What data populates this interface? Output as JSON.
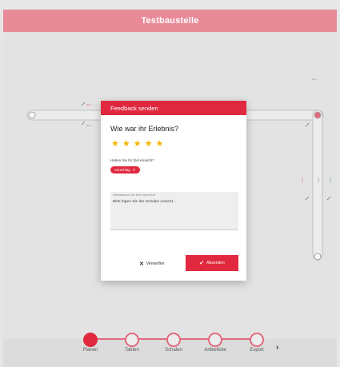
{
  "app": {
    "title": "Testbaustelle"
  },
  "colors": {
    "accent": "#e0293f",
    "header": "#e88a98",
    "star": "#f4b400"
  },
  "canvas": {
    "marks": [
      "30,6",
      "30,6",
      "24,0",
      "24,0",
      "24,0",
      "24,0"
    ]
  },
  "feedback_dialog": {
    "title": "Feedback senden",
    "question": "Wie war ihr Erlebnis?",
    "rating": 5,
    "rating_max": 5,
    "goal_question": "Haben Sie ihr Ziel erreicht?",
    "chip_label": "Vorschlag",
    "message_label": "Hinterlassen Sie eine Nachricht",
    "message_value": "Bitte fügen Sie der Schalen Ansicht...",
    "discard_label": "Verwerfen",
    "send_label": "Absenden",
    "discard_icon": "close-icon",
    "send_icon": "check-icon"
  },
  "stepper": {
    "steps": [
      {
        "label": "Planen",
        "active": true
      },
      {
        "label": "Takten",
        "active": false
      },
      {
        "label": "Schalen",
        "active": false
      },
      {
        "label": "Artikelliste",
        "active": false
      },
      {
        "label": "Export",
        "active": false
      }
    ],
    "next_icon": "chevron-right-icon"
  }
}
